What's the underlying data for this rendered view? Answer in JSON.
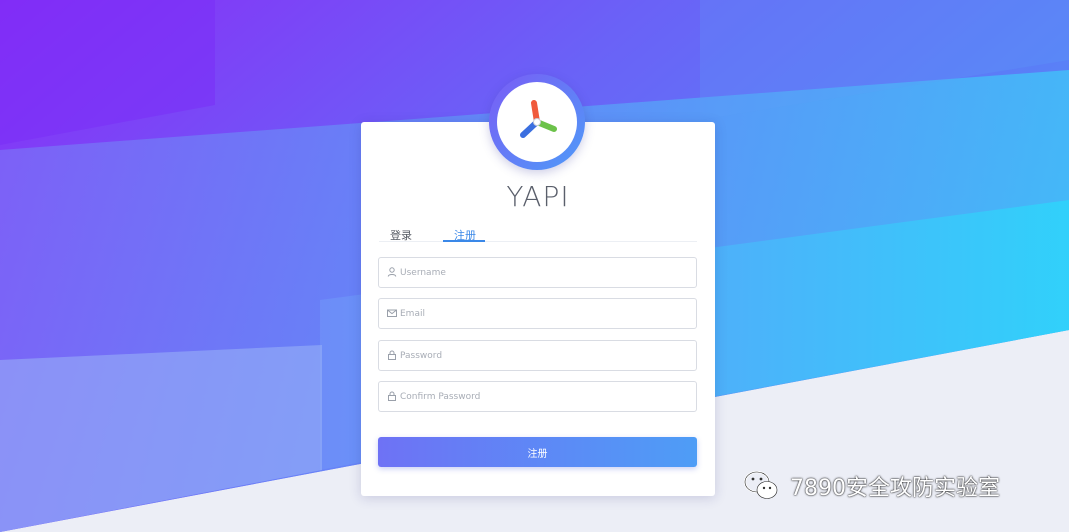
{
  "app": {
    "title": "YAPI"
  },
  "colors": {
    "accent": "#3a88e8",
    "button_start": "#6e72f5",
    "button_end": "#4e9df6"
  },
  "tabs": [
    {
      "label": "登录",
      "active": false
    },
    {
      "label": "注册",
      "active": true
    }
  ],
  "form": {
    "username": {
      "placeholder": "Username",
      "value": "",
      "icon": "user-icon"
    },
    "email": {
      "placeholder": "Email",
      "value": "",
      "icon": "mail-icon"
    },
    "password": {
      "placeholder": "Password",
      "value": "",
      "icon": "lock-icon"
    },
    "confirm_password": {
      "placeholder": "Confirm Password",
      "value": "",
      "icon": "lock-icon"
    },
    "submit_label": "注册"
  },
  "watermark": {
    "text": "7890安全攻防实验室",
    "icon": "wechat-icon"
  }
}
